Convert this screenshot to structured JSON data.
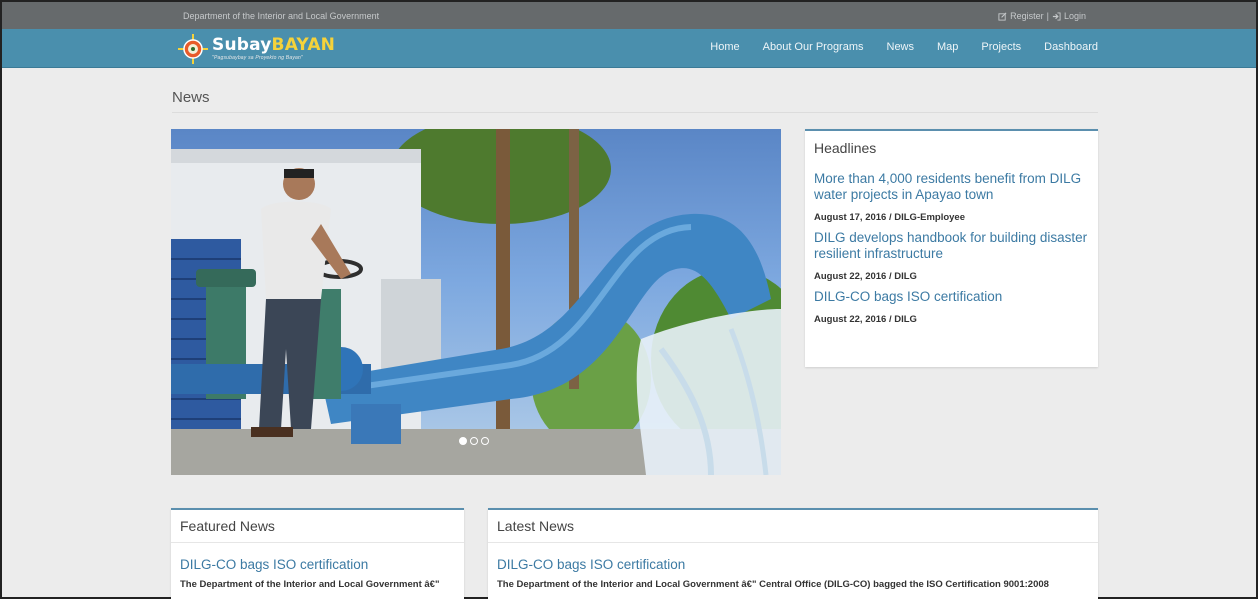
{
  "topbar": {
    "department": "Department of the Interior and Local Government",
    "register_label": "Register",
    "separator": "|",
    "login_label": "Login"
  },
  "brand": {
    "title_part1": "Subay",
    "title_part2": "BAYAN",
    "tagline": "\"Pagsubaybay sa Proyekto ng Bayan\""
  },
  "nav": {
    "items": [
      "Home",
      "About Our Programs",
      "News",
      "Map",
      "Projects",
      "Dashboard"
    ]
  },
  "page": {
    "title": "News"
  },
  "carousel": {
    "slide_count": 3,
    "active_index": 0
  },
  "headlines": {
    "title": "Headlines",
    "items": [
      {
        "title": "More than 4,000 residents benefit from DILG water projects in Apayao town",
        "meta": "August 17, 2016 / DILG-Employee"
      },
      {
        "title": "DILG develops handbook for building disaster resilient infrastructure",
        "meta": "August 22, 2016 / DILG"
      },
      {
        "title": "DILG-CO bags ISO certification",
        "meta": "August 22, 2016 / DILG"
      }
    ]
  },
  "featured": {
    "title": "Featured News",
    "item_title": "DILG-CO bags ISO certification",
    "item_text": "The Department of the Interior and Local Government â€\""
  },
  "latest": {
    "title": "Latest News",
    "item_title": "DILG-CO bags ISO certification",
    "item_text": "The Department of the Interior and Local Government â€\" Central Office (DILG-CO) bagged the ISO Certification 9001:2008"
  },
  "colors": {
    "topbar": "#666a6c",
    "navbar": "#4a8fad",
    "link": "#3c7aa3",
    "panel_accent": "#5b8fae"
  }
}
